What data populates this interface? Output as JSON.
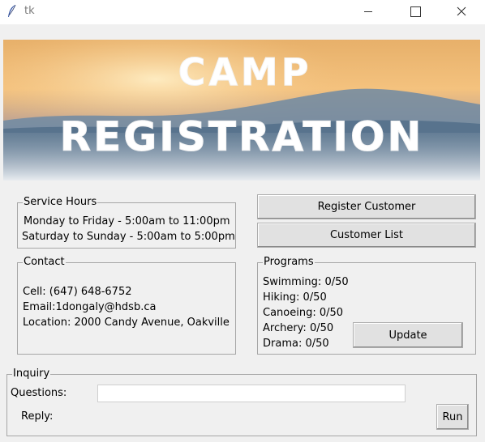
{
  "window": {
    "title": "tk",
    "app_icon": "feather-icon",
    "controls": {
      "minimize": "minimize-icon",
      "maximize": "maximize-icon",
      "close": "close-icon"
    }
  },
  "banner": {
    "line1": "CAMP",
    "line2": "REGISTRATION"
  },
  "service_hours": {
    "legend": "Service Hours",
    "lines": [
      "Monday to Friday - 5:00am to 11:00pm",
      "Saturday to Sunday - 5:00am to 5:00pm"
    ]
  },
  "contact": {
    "legend": "Contact",
    "cell": "Cell: (647) 648-6752",
    "email": "Email:1dongaly@hdsb.ca",
    "location": "Location: 2000 Candy Avenue, Oakville"
  },
  "buttons": {
    "register": "Register Customer",
    "customer_list": "Customer List",
    "update": "Update",
    "run": "Run"
  },
  "programs": {
    "legend": "Programs",
    "items": [
      "Swimming: 0/50",
      "Hiking: 0/50",
      "Canoeing: 0/50",
      "Archery: 0/50",
      "Drama: 0/50"
    ]
  },
  "inquiry": {
    "legend": "Inquiry",
    "questions_label": "Questions:",
    "questions_value": "",
    "reply_label": "Reply:"
  },
  "colors": {
    "window_bg": "#f0f0f0",
    "banner_sky_top": "#f2b56b",
    "banner_mountains": "#5c7891",
    "banner_fog": "#d6dde4"
  }
}
